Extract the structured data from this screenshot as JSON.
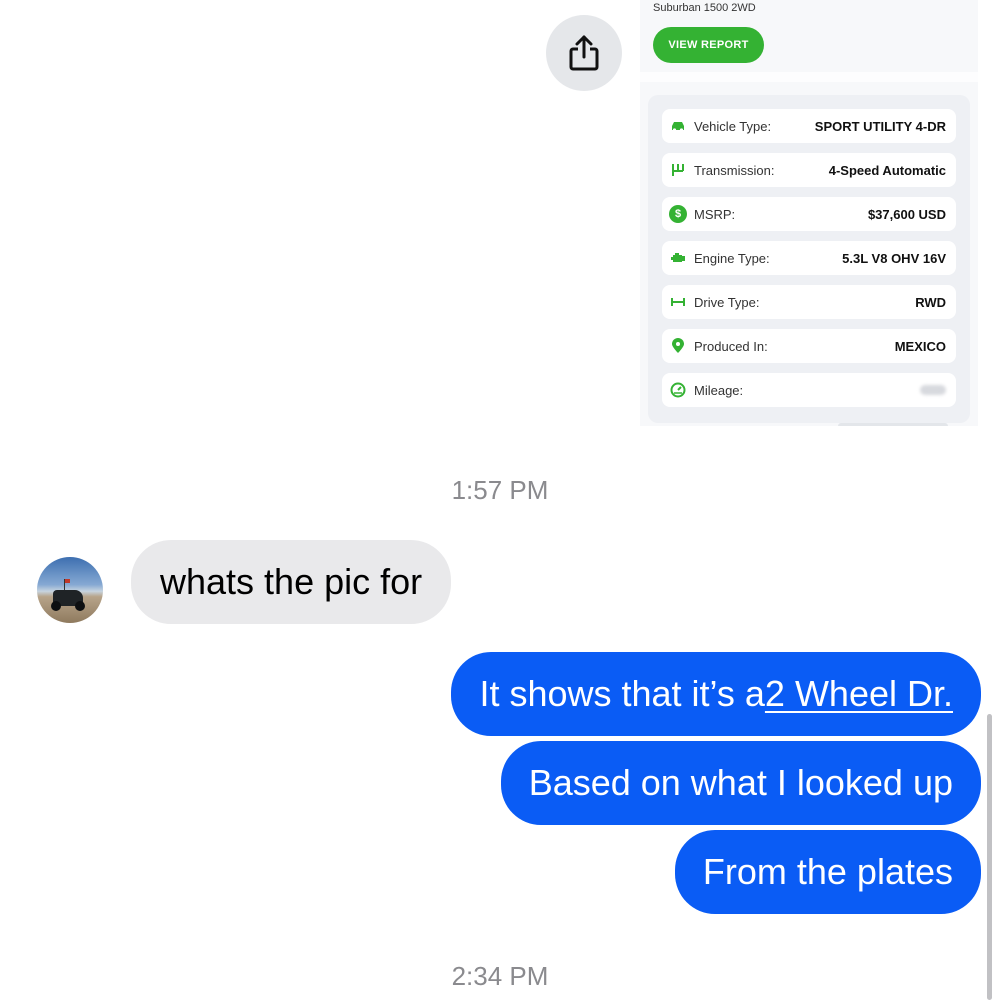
{
  "shared_card": {
    "model": "Suburban 1500 2WD",
    "view_report_label": "VIEW REPORT",
    "specs": [
      {
        "label": "Vehicle Type:",
        "value": "SPORT UTILITY 4-DR",
        "icon": "car-icon"
      },
      {
        "label": "Transmission:",
        "value": "4-Speed Automatic",
        "icon": "gear-shift-icon"
      },
      {
        "label": "MSRP:",
        "value": "$37,600 USD",
        "icon": "dollar-icon"
      },
      {
        "label": "Engine Type:",
        "value": "5.3L V8 OHV 16V",
        "icon": "engine-icon"
      },
      {
        "label": "Drive Type:",
        "value": "RWD",
        "icon": "axle-icon"
      },
      {
        "label": "Produced In:",
        "value": "MEXICO",
        "icon": "location-pin-icon"
      },
      {
        "label": "Mileage:",
        "value": "",
        "icon": "speedometer-icon",
        "blurred": true
      }
    ],
    "accent_color": "#34b233"
  },
  "share_button": {
    "icon": "share-icon"
  },
  "timestamps": [
    "1:57 PM",
    "2:34 PM"
  ],
  "incoming": [
    {
      "text": "whats the pic for"
    }
  ],
  "outgoing": [
    {
      "text_before": "It shows that it’s a ",
      "link_text": "2 Wheel Dr."
    },
    {
      "text": "Based on what I looked up"
    },
    {
      "text": "From the plates"
    }
  ],
  "colors": {
    "outgoing_bubble": "#0a5cf5",
    "incoming_bubble": "#e9e9eb",
    "timestamp": "#8a8a8e"
  }
}
